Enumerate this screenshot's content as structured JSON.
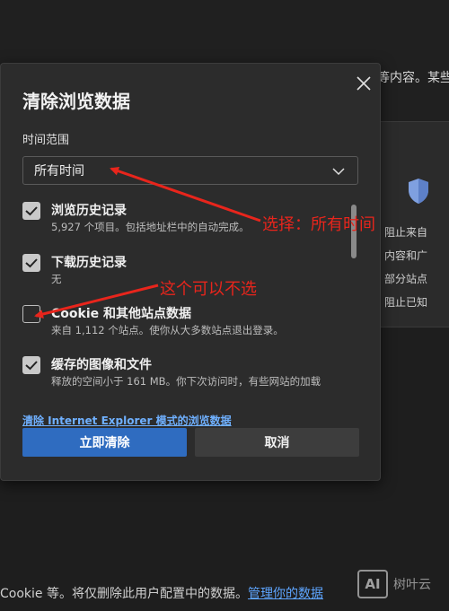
{
  "background": {
    "top_text": "等内容。某些",
    "card_list": [
      "阻止来自",
      "内容和广",
      "部分站点",
      "阻止已知"
    ],
    "bottom_text": "Cookie 等。将仅删除此用户配置中的数据。",
    "bottom_link": "管理你的数据",
    "watermark_logo": "AI",
    "watermark_text": "树叶云"
  },
  "dialog": {
    "title": "清除浏览数据",
    "range_label": "时间范围",
    "range_selected": "所有时间",
    "items": [
      {
        "title": "浏览历史记录",
        "desc": "5,927 个项目。包括地址栏中的自动完成。",
        "checked": true
      },
      {
        "title": "下载历史记录",
        "desc": "无",
        "checked": true
      },
      {
        "title": "Cookie 和其他站点数据",
        "desc": "来自 1,112 个站点。使你从大多数站点退出登录。",
        "checked": false
      },
      {
        "title": "缓存的图像和文件",
        "desc": "释放的空间小于 161 MB。你下次访问时，有些网站的加载",
        "checked": true
      }
    ],
    "ie_link": "清除 Internet Explorer 模式的浏览数据",
    "clear_button": "立即清除",
    "cancel_button": "取消"
  },
  "annotations": {
    "select_note": "选择：所有时间",
    "cookie_note": "这个可以不选",
    "color": "#e8251c"
  }
}
